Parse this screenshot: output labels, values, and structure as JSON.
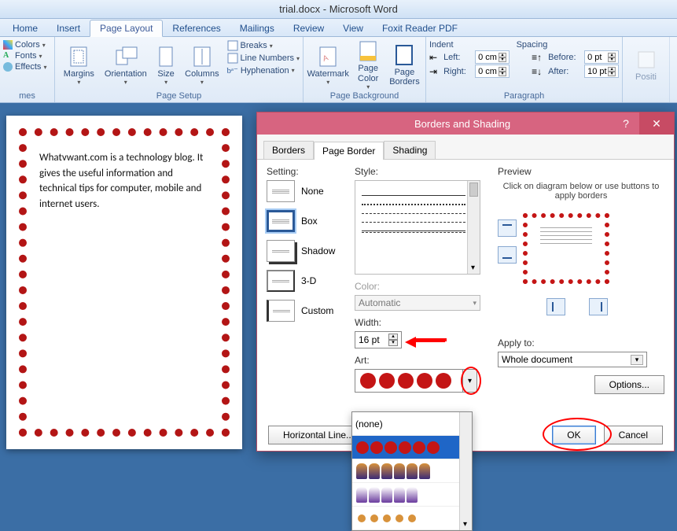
{
  "title": "trial.docx - Microsoft Word",
  "tabs": {
    "home": "Home",
    "insert": "Insert",
    "page_layout": "Page Layout",
    "references": "References",
    "mailings": "Mailings",
    "review": "Review",
    "view": "View",
    "foxit": "Foxit Reader PDF"
  },
  "ribbon": {
    "themes": {
      "label": "mes",
      "colors": "Colors",
      "fonts": "Fonts",
      "effects": "Effects"
    },
    "page_setup": {
      "label": "Page Setup",
      "margins": "Margins",
      "orientation": "Orientation",
      "size": "Size",
      "columns": "Columns",
      "breaks": "Breaks",
      "line_numbers": "Line Numbers",
      "hyphenation": "Hyphenation"
    },
    "page_bg": {
      "label": "Page Background",
      "watermark": "Watermark",
      "page_color": "Page\nColor",
      "page_borders": "Page\nBorders"
    },
    "paragraph": {
      "label": "Paragraph",
      "indent": "Indent",
      "spacing": "Spacing",
      "left": "Left:",
      "right": "Right:",
      "before": "Before:",
      "after": "After:",
      "left_val": "0 cm",
      "right_val": "0 cm",
      "before_val": "0 pt",
      "after_val": "10 pt"
    },
    "arrange": {
      "position": "Positi"
    }
  },
  "document": {
    "text": "Whatvwant.com is a technology blog. It gives the useful information and technical tips for computer, mobile and internet users."
  },
  "dialog": {
    "title": "Borders and Shading",
    "tabs": {
      "borders": "Borders",
      "page_border": "Page Border",
      "shading": "Shading"
    },
    "setting_label": "Setting:",
    "setting": {
      "none": "None",
      "box": "Box",
      "shadow": "Shadow",
      "threed": "3-D",
      "custom": "Custom"
    },
    "style_label": "Style:",
    "color_label": "Color:",
    "color_value": "Automatic",
    "width_label": "Width:",
    "width_value": "16 pt",
    "art_label": "Art:",
    "art_dropdown_none": "(none)",
    "preview_label": "Preview",
    "preview_hint": "Click on diagram below or use buttons to apply borders",
    "apply_label": "Apply to:",
    "apply_value": "Whole document",
    "options_btn": "Options...",
    "horiz_line_btn": "Horizontal Line...",
    "ok": "OK",
    "cancel": "Cancel"
  }
}
